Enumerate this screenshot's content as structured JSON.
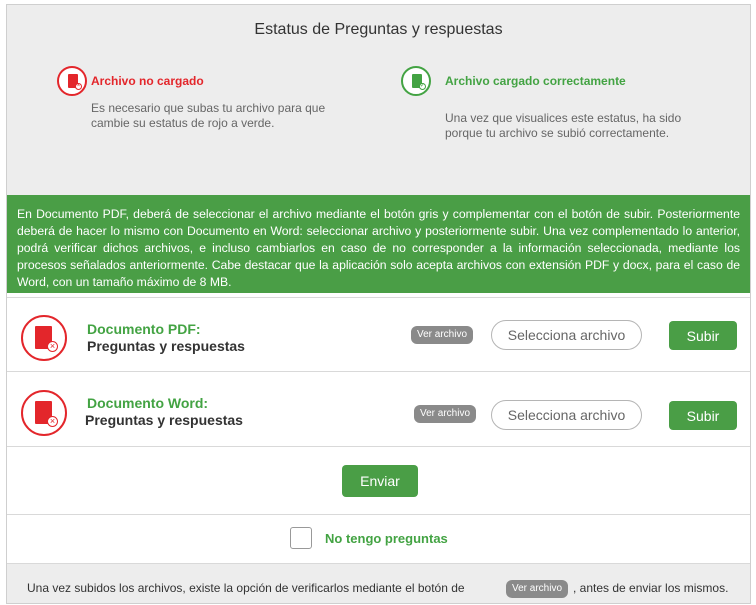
{
  "status": {
    "title": "Estatus de Preguntas y respuestas",
    "not_loaded": {
      "icon": "document-error-icon",
      "title": "Archivo no cargado",
      "desc_line1": "Es necesario que subas tu archivo para que",
      "desc_line2": "cambie su estatus de rojo a verde.",
      "color": "#e3262b"
    },
    "loaded": {
      "icon": "document-check-icon",
      "title": "Archivo cargado correctamente",
      "desc_line1": "Una vez que visualices este estatus, ha sido",
      "desc_line2": "porque tu archivo se subió correctamente.",
      "color": "#43a343"
    }
  },
  "instructions": {
    "text": "En Documento PDF, deberá de seleccionar el archivo mediante el botón gris y complementar con el botón de subir. Posteriormente deberá de hacer lo mismo con Documento en Word: seleccionar archivo y posteriormente subir. Una vez complementado lo anterior, podrá verificar dichos archivos, e incluso cambiarlos en caso de no corresponder a la información seleccionada, mediante los procesos señalados anteriormente. Cabe destacar que la aplicación solo acepta archivos con extensión PDF y docx, para el caso de Word, con un tamaño máximo de 8 MB.",
    "background": "#4a9e46"
  },
  "documents": [
    {
      "title": "Documento PDF:",
      "subtitle": "Preguntas y respuestas",
      "view_label": "Ver archivo",
      "select_label": "Selecciona archivo",
      "upload_label": "Subir"
    },
    {
      "title": "Documento Word:",
      "subtitle": "Preguntas y respuestas",
      "view_label": "Ver archivo",
      "select_label": "Selecciona archivo",
      "upload_label": "Subir"
    }
  ],
  "submit": {
    "label": "Enviar"
  },
  "no_questions": {
    "label": "No tengo preguntas",
    "checked": false
  },
  "footer": {
    "text_before": "Una vez subidos los archivos, existe la opción de verificarlos mediante el botón de",
    "button_label": "Ver archivo",
    "text_after": ", antes de enviar los mismos."
  }
}
